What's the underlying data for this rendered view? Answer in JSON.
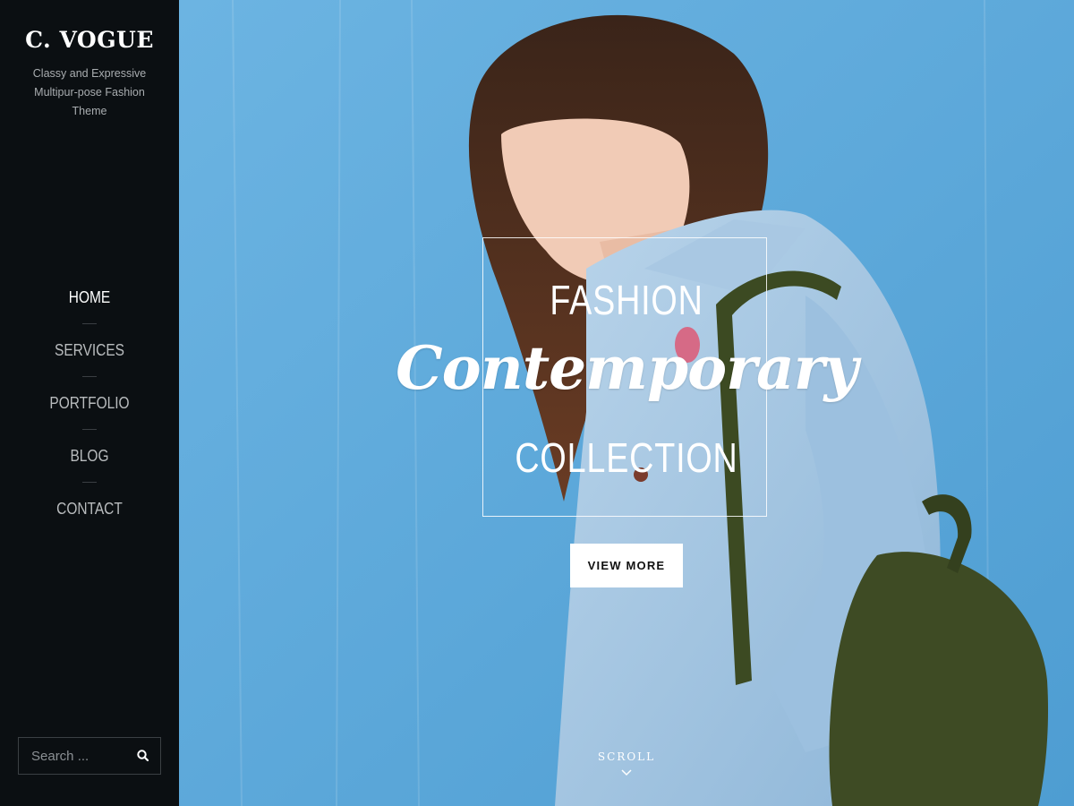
{
  "site": {
    "title": "C. VOGUE",
    "tagline": "Classy and Expressive Multipur-pose Fashion Theme"
  },
  "nav": {
    "items": [
      {
        "label": "HOME",
        "active": true
      },
      {
        "label": "SERVICES",
        "active": false
      },
      {
        "label": "PORTFOLIO",
        "active": false
      },
      {
        "label": "BLOG",
        "active": false
      },
      {
        "label": "CONTACT",
        "active": false
      }
    ]
  },
  "search": {
    "placeholder": "Search ...",
    "icon": "search-icon"
  },
  "hero": {
    "line1": "FASHION",
    "line2": "Contemporary",
    "line3": "COLLECTION",
    "cta_label": "VIEW MORE",
    "scroll_label": "SCROLL",
    "scroll_icon": "chevron-down-icon"
  },
  "colors": {
    "sidebar_bg": "#0b0f12",
    "hero_bg": "#5aa8da",
    "cta_bg": "#ffffff",
    "nav_active": "#ffffff",
    "nav_inactive": "#b9bcbe"
  }
}
